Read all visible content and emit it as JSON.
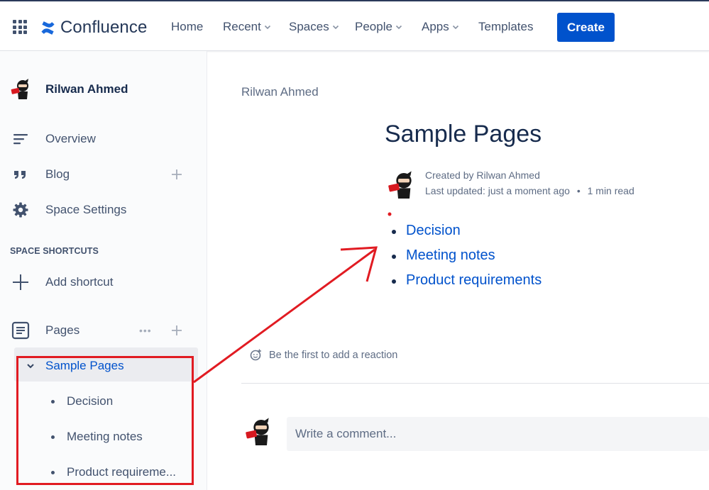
{
  "header": {
    "logo_text": "Confluence",
    "nav": [
      {
        "label": "Home",
        "dropdown": false
      },
      {
        "label": "Recent",
        "dropdown": true
      },
      {
        "label": "Spaces",
        "dropdown": true
      },
      {
        "label": "People",
        "dropdown": true
      },
      {
        "label": "Apps",
        "dropdown": true
      },
      {
        "label": "Templates",
        "dropdown": false
      }
    ],
    "create_label": "Create"
  },
  "sidebar": {
    "space_name": "Rilwan Ahmed",
    "items": [
      {
        "label": "Overview",
        "icon": "overview-icon"
      },
      {
        "label": "Blog",
        "icon": "quote-icon"
      },
      {
        "label": "Space Settings",
        "icon": "gear-icon"
      }
    ],
    "shortcuts_title": "SPACE SHORTCUTS",
    "add_shortcut_label": "Add shortcut",
    "pages_label": "Pages",
    "pages_more": "•••",
    "tree": {
      "parent": "Sample Pages",
      "children": [
        "Decision",
        "Meeting notes",
        "Product requireme..."
      ]
    }
  },
  "content": {
    "breadcrumb": "Rilwan Ahmed",
    "title": "Sample Pages",
    "created_by": "Created by Rilwan Ahmed",
    "last_updated": "Last updated: just a moment ago",
    "separator": "•",
    "read_time": "1 min read",
    "child_pages": [
      "Decision",
      "Meeting notes",
      "Product requirements"
    ],
    "reaction_text": "Be the first to add a reaction",
    "comment_placeholder": "Write a comment..."
  },
  "colors": {
    "brand": "#0052cc",
    "annotation": "#e11b22",
    "text": "#172b4d",
    "subtle": "#42526e"
  }
}
